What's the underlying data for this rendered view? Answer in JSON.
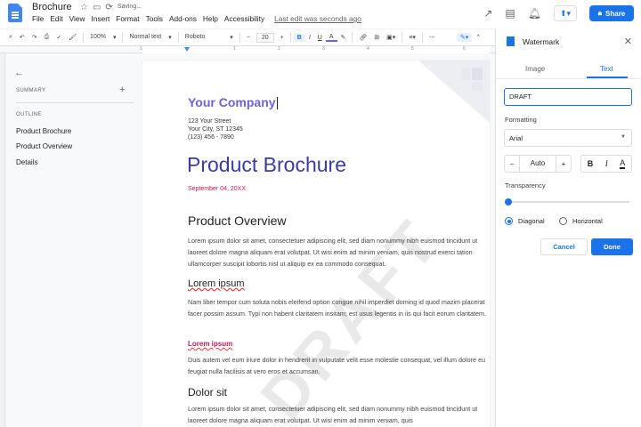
{
  "header": {
    "doc_title": "Brochure",
    "saving_status": "Saving...",
    "menu": [
      "File",
      "Edit",
      "View",
      "Insert",
      "Format",
      "Tools",
      "Add-ons",
      "Help",
      "Accessibility"
    ],
    "last_edit": "Last edit was seconds ago",
    "share_label": "Share"
  },
  "toolbar": {
    "zoom": "100%",
    "style": "Normal text",
    "font": "Roboto",
    "font_size": "20",
    "minus": "−",
    "plus": "+"
  },
  "ruler": {
    "labels": [
      "1",
      "1",
      "2",
      "3",
      "4",
      "5",
      "6"
    ]
  },
  "sidebar": {
    "summary_label": "SUMMARY",
    "outline_label": "OUTLINE",
    "outline_items": [
      "Product Brochure",
      "Product Overview",
      "Details"
    ]
  },
  "document": {
    "company": "Your Company",
    "address": [
      "123 Your Street",
      "Your City, ST 12345",
      "(123) 456 - 7890"
    ],
    "title": "Product Brochure",
    "date": "September 04, 20XX",
    "heading_overview": "Product Overview",
    "para1": "Lorem ipsum dolor sit amet, consectetuer adipiscing elit, sed diam nonummy nibh euismod tincidunt ut laoreet dolore magna aliquam erat volutpat. Ut wisi enim ad minim veniam, quis nostrud exerci tation ullamcorper suscipit lobortis nisl ut aliquip ex ea commodo consequat.",
    "heading_lorem": "Lorem ipsum",
    "para2": "Nam liber tempor cum soluta nobis eleifend option congue nihil imperdiet doming id quod mazim placerat facer possim assum. Typi non habent claritatem insitam; est usus legentis in iis qui facit eorum claritatem.",
    "sub_lorem": "Lorem ipsum",
    "para3": "Duis autem vel eum iriure dolor in hendrerit in vulputate velit esse molestie consequat, vel illum dolore eu feugiat nulla facilisis at vero eros et accumsan.",
    "heading_dolor": "Dolor sit",
    "para4": "Lorem ipsum dolor sit amet, consectetuer adipiscing elit, sed diam nonummy nibh euismod tincidunt ut laoreet dolore magna aliquam erat volutpat. Ut wisi enim ad minim veniam, quis",
    "watermark_text": "DRAFT"
  },
  "watermark_panel": {
    "title": "Watermark",
    "tabs": [
      "Image",
      "Text"
    ],
    "active_tab": "Text",
    "text_value": "DRAFT",
    "formatting_label": "Formatting",
    "font_value": "Arial",
    "size_value": "Auto",
    "size_minus": "−",
    "size_plus": "+",
    "bold": "B",
    "italic": "I",
    "color": "A",
    "transparency_label": "Transparency",
    "transparency_value": 0,
    "orientation_options": [
      "Diagonal",
      "Horizontal"
    ],
    "orientation_selected": "Diagonal",
    "cancel_label": "Cancel",
    "done_label": "Done"
  },
  "colors": {
    "accent": "#1a73e8",
    "company": "#6c63d8",
    "title": "#3c3ba0",
    "date": "#c2185b"
  }
}
